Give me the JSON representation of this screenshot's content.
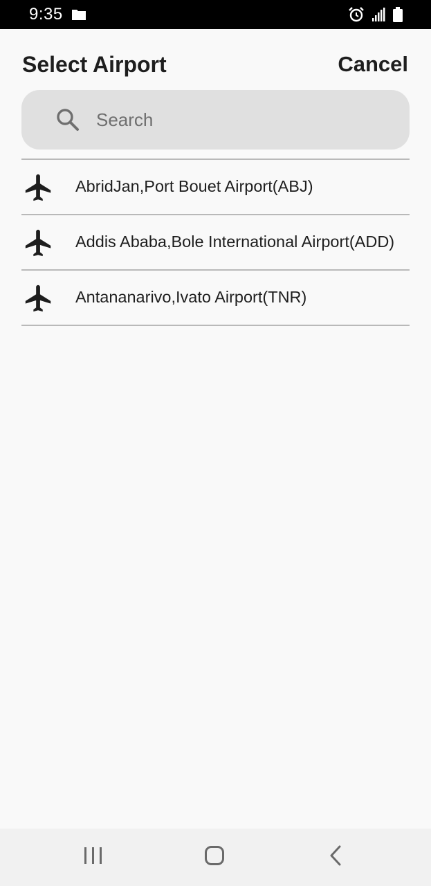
{
  "status_bar": {
    "time": "9:35",
    "icons": [
      "folder-icon",
      "alarm-icon",
      "signal-icon",
      "battery-icon"
    ]
  },
  "header": {
    "title": "Select Airport",
    "cancel_label": "Cancel"
  },
  "search": {
    "placeholder": "Search",
    "value": "",
    "icon": "search-icon"
  },
  "airports": [
    {
      "label": "AbridJan,Port Bouet Airport(ABJ)",
      "icon": "airplane-icon"
    },
    {
      "label": "Addis Ababa,Bole International Airport(ADD)",
      "icon": "airplane-icon"
    },
    {
      "label": "Antananarivo,Ivato Airport(TNR)",
      "icon": "airplane-icon"
    }
  ],
  "nav_bar": {
    "buttons": [
      "recent-apps-icon",
      "home-icon",
      "back-icon"
    ]
  },
  "colors": {
    "background": "#f9f9f9",
    "text": "#1e1e1e",
    "search_bg": "#e0e0e0",
    "divider": "#b9b9b9",
    "status_bar": "#000000"
  }
}
